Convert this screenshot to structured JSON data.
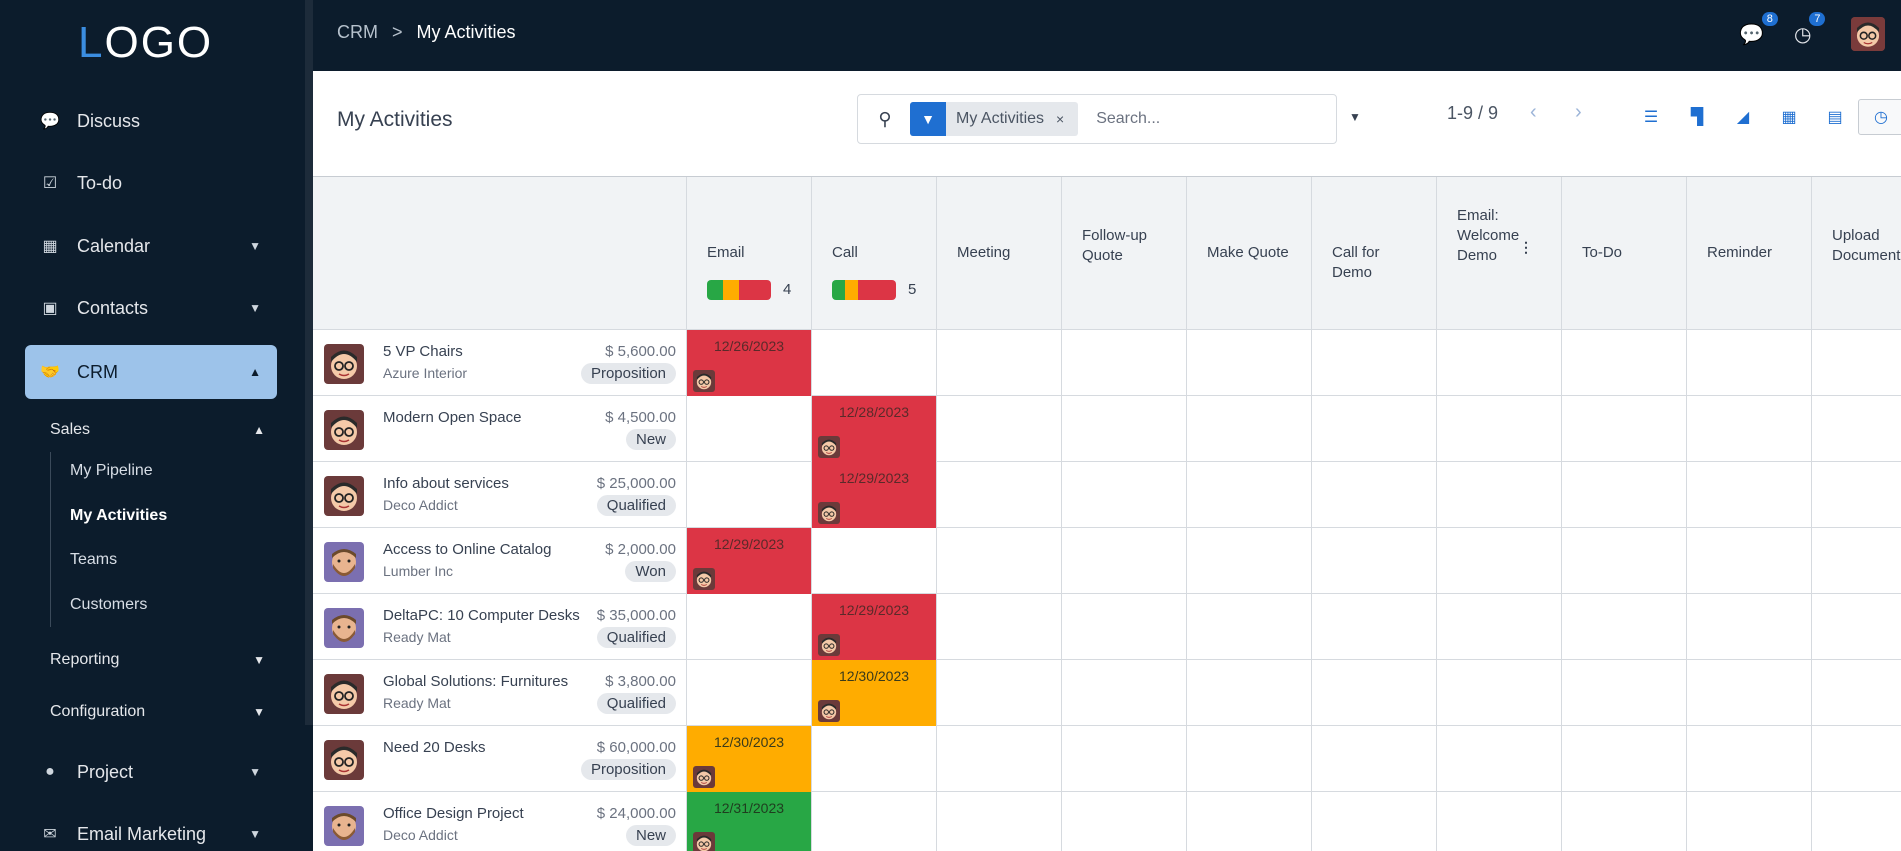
{
  "logo": {
    "first": "L",
    "rest": "OGO"
  },
  "topbar": {
    "breadcrumb_root": "CRM",
    "breadcrumb_sep": ">",
    "breadcrumb_current": "My Activities",
    "messages_count": "8",
    "activities_count": "7"
  },
  "sidebar": {
    "items": [
      {
        "label": "Discuss",
        "icon": "chat-icon"
      },
      {
        "label": "To-do",
        "icon": "checkbox-icon"
      },
      {
        "label": "Calendar",
        "icon": "calendar-icon"
      },
      {
        "label": "Contacts",
        "icon": "contact-card-icon"
      },
      {
        "label": "CRM",
        "icon": "handshake-icon"
      },
      {
        "label": "Project",
        "icon": "project-icon"
      },
      {
        "label": "Email Marketing",
        "icon": "envelope-icon"
      }
    ],
    "crm_sub": {
      "sales": "Sales",
      "sales_items": [
        "My Pipeline",
        "My Activities",
        "Teams",
        "Customers"
      ],
      "reporting": "Reporting",
      "configuration": "Configuration"
    }
  },
  "control_panel": {
    "title": "My Activities",
    "facet_label": "My Activities",
    "facet_remove": "×",
    "search_placeholder": "Search...",
    "pager": "1-9 / 9"
  },
  "columns": [
    {
      "label": "Email",
      "count": "4",
      "bar": [
        {
          "color": "#28a745",
          "pct": 25
        },
        {
          "color": "#ffac00",
          "pct": 25
        },
        {
          "color": "#dc3545",
          "pct": 50
        }
      ]
    },
    {
      "label": "Call",
      "count": "5",
      "bar": [
        {
          "color": "#28a745",
          "pct": 20
        },
        {
          "color": "#ffac00",
          "pct": 20
        },
        {
          "color": "#dc3545",
          "pct": 60
        }
      ]
    },
    {
      "label": "Meeting"
    },
    {
      "label": "Follow-up Quote"
    },
    {
      "label": "Make Quote"
    },
    {
      "label": "Call for Demo"
    },
    {
      "label": "Email: Welcome Demo"
    },
    {
      "label": "To-Do"
    },
    {
      "label": "Reminder"
    },
    {
      "label": "Upload Document"
    }
  ],
  "rows": [
    {
      "name": "5 VP Chairs",
      "company": "Azure Interior",
      "amount": "$ 5,600.00",
      "stage": "Proposition",
      "avatar": "man-glasses",
      "act_col": 0,
      "act_date": "12/26/2023",
      "act_state": "red"
    },
    {
      "name": "Modern Open Space",
      "company": "",
      "amount": "$ 4,500.00",
      "stage": "New",
      "avatar": "man-glasses",
      "act_col": 1,
      "act_date": "12/28/2023",
      "act_state": "red"
    },
    {
      "name": "Info about services",
      "company": "Deco Addict",
      "amount": "$ 25,000.00",
      "stage": "Qualified",
      "avatar": "man-glasses",
      "act_col": 1,
      "act_date": "12/29/2023",
      "act_state": "red"
    },
    {
      "name": "Access to Online Catalog",
      "company": "Lumber Inc",
      "amount": "$ 2,000.00",
      "stage": "Won",
      "avatar": "man-beard",
      "act_col": 0,
      "act_date": "12/29/2023",
      "act_state": "red"
    },
    {
      "name": "DeltaPC: 10 Computer Desks",
      "company": "Ready Mat",
      "amount": "$ 35,000.00",
      "stage": "Qualified",
      "avatar": "man-beard",
      "act_col": 1,
      "act_date": "12/29/2023",
      "act_state": "red"
    },
    {
      "name": "Global Solutions: Furnitures",
      "company": "Ready Mat",
      "amount": "$ 3,800.00",
      "stage": "Qualified",
      "avatar": "man-glasses",
      "act_col": 1,
      "act_date": "12/30/2023",
      "act_state": "orange"
    },
    {
      "name": "Need 20 Desks",
      "company": "",
      "amount": "$ 60,000.00",
      "stage": "Proposition",
      "avatar": "man-glasses",
      "act_col": 0,
      "act_date": "12/30/2023",
      "act_state": "orange"
    },
    {
      "name": "Office Design Project",
      "company": "Deco Addict",
      "amount": "$ 24,000.00",
      "stage": "New",
      "avatar": "man-beard",
      "act_col": 0,
      "act_date": "12/31/2023",
      "act_state": "green"
    }
  ]
}
